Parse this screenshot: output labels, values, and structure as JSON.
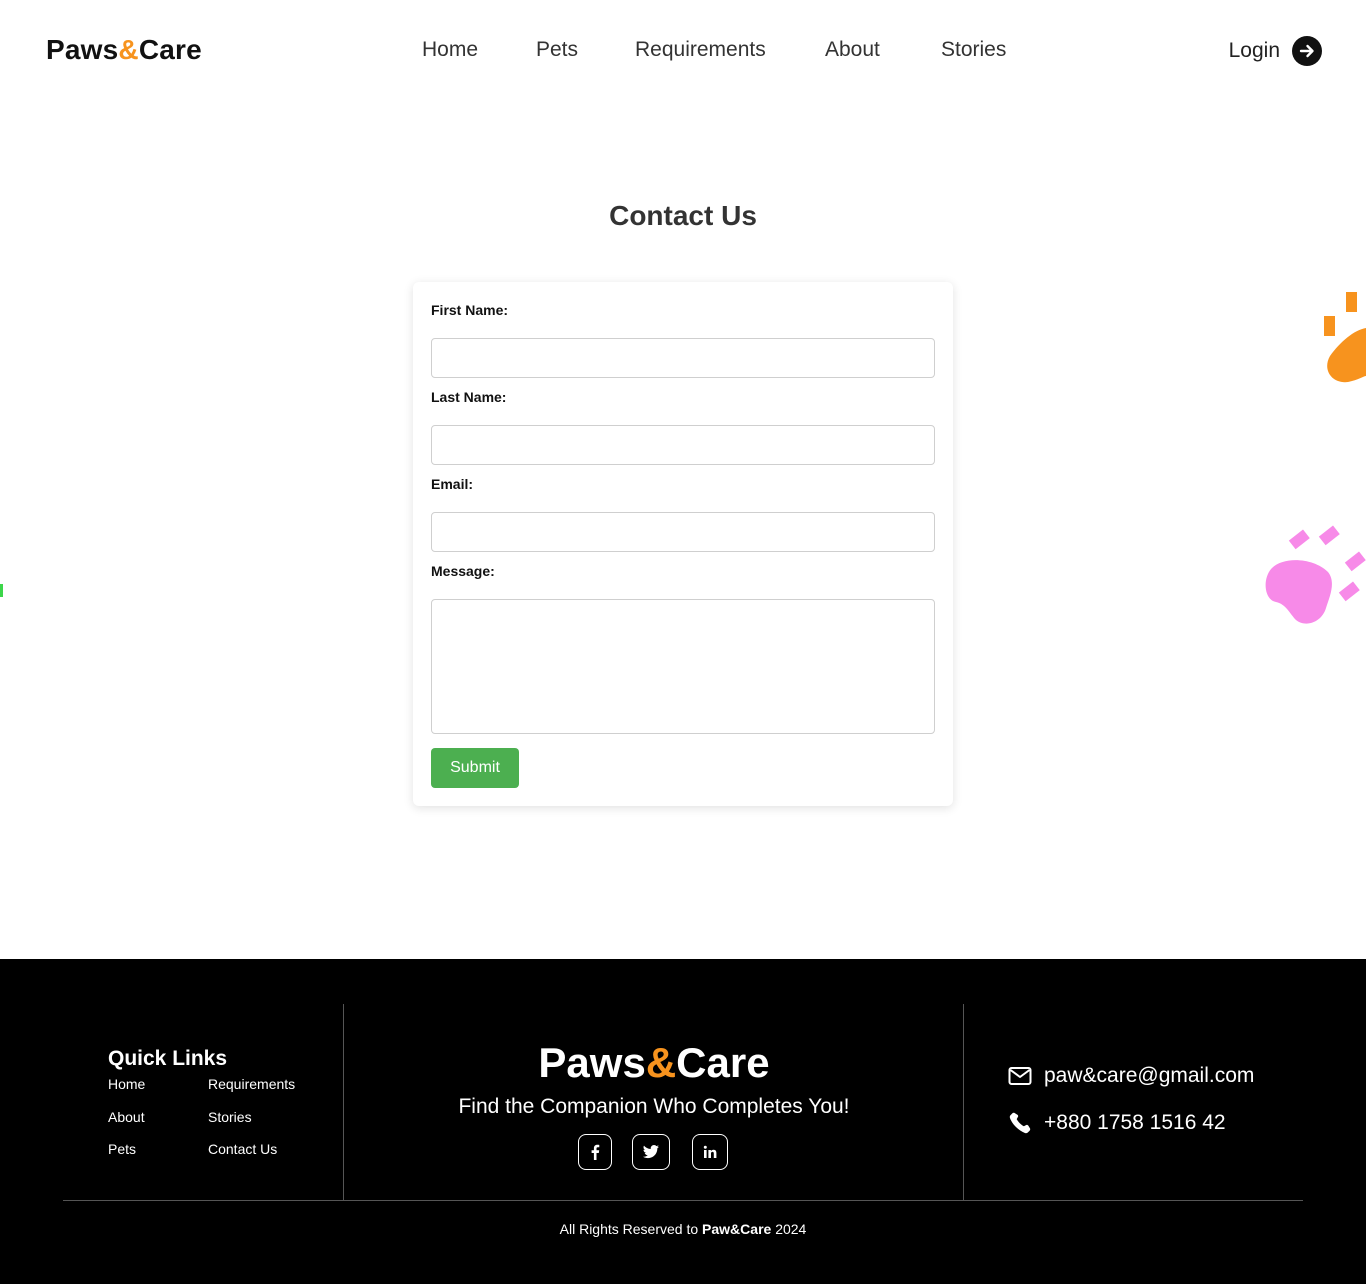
{
  "header": {
    "logo": {
      "part1": "Paws",
      "amp": "&",
      "part2": "Care"
    },
    "nav": [
      "Home",
      "Pets",
      "Requirements",
      "About",
      "Stories"
    ],
    "login_label": "Login"
  },
  "main": {
    "title": "Contact Us",
    "form": {
      "first_name_label": "First Name:",
      "last_name_label": "Last Name:",
      "email_label": "Email:",
      "message_label": "Message:",
      "first_name_value": "",
      "last_name_value": "",
      "email_value": "",
      "message_value": "",
      "submit_label": "Submit"
    }
  },
  "footer": {
    "quick_links_title": "Quick Links",
    "quick_links": [
      "Home",
      "Requirements",
      "About",
      "Stories",
      "Pets",
      "Contact Us"
    ],
    "logo": {
      "part1": "Paws",
      "amp": "&",
      "part2": "Care"
    },
    "tagline": "Find the Companion Who Completes You!",
    "social": [
      "facebook-icon",
      "twitter-icon",
      "linkedin-icon"
    ],
    "email": "paw&care@gmail.com",
    "phone": "+880 1758 1516 42",
    "copyright": {
      "prefix": "All Rights Reserved to ",
      "brand": "Paw&Care",
      "year": " 2024"
    }
  },
  "colors": {
    "accent_orange": "#f7931e",
    "submit_green": "#4caf50",
    "decor_pink": "#f78ae8",
    "footer_bg": "#000000"
  }
}
